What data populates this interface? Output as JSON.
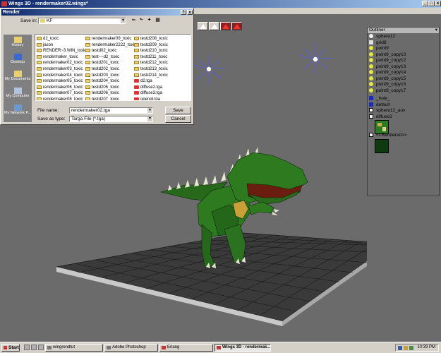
{
  "app": {
    "title": "Wings 3D - rendermaker02.wings*",
    "minimize_glyph": "_",
    "maximize_glyph": "□",
    "close_glyph": "x"
  },
  "viewport": {
    "toolbar_modes": [
      "vertex-mode",
      "edge-mode",
      "face-mode",
      "body-mode"
    ],
    "active_modes": [
      2,
      3
    ]
  },
  "outliner": {
    "title": "Outliner",
    "items": [
      {
        "label": "sphere12",
        "icon": "sphere-icon"
      },
      {
        "label": "grid8",
        "icon": "grid-icon"
      },
      {
        "label": "point9",
        "icon": "light-icon"
      },
      {
        "label": "point9_copy10",
        "icon": "light-icon"
      },
      {
        "label": "point9_copy12",
        "icon": "light-icon"
      },
      {
        "label": "point9_copy13",
        "icon": "light-icon"
      },
      {
        "label": "point9_copy14",
        "icon": "light-icon"
      },
      {
        "label": "point9_copy15",
        "icon": "light-icon"
      },
      {
        "label": "point9_copy16",
        "icon": "light-icon"
      },
      {
        "label": "point9_copy17",
        "icon": "light-icon"
      },
      {
        "label": "_hole_",
        "icon": "material-icon"
      },
      {
        "label": "default",
        "icon": "material-icon"
      },
      {
        "label": "sphere12_auv",
        "icon": "image-icon"
      },
      {
        "label": "diffuse2",
        "icon": "image-icon"
      },
      {
        "label": "<<Rendered>>",
        "icon": "image-icon"
      }
    ]
  },
  "dialog": {
    "title": "Render",
    "help_glyph": "?",
    "close_glyph": "x",
    "save_in_label": "Save in:",
    "save_in_value": "KF",
    "places": [
      {
        "label": "History",
        "icon": "history-icon"
      },
      {
        "label": "Desktop",
        "icon": "desktop-icon"
      },
      {
        "label": "My Documents",
        "icon": "my-documents-icon"
      },
      {
        "label": "My Computer",
        "icon": "my-computer-icon"
      },
      {
        "label": "My Network P...",
        "icon": "my-network-icon"
      }
    ],
    "files": [
      {
        "name": "d2_toxic",
        "type": "folder"
      },
      {
        "name": "jason",
        "type": "folder"
      },
      {
        "name": "RENDER~3.WIN_toxic",
        "type": "folder"
      },
      {
        "name": "rendermaker_toxic",
        "type": "folder"
      },
      {
        "name": "rendermaker02_toxic",
        "type": "folder"
      },
      {
        "name": "rendermaker03_toxic",
        "type": "folder"
      },
      {
        "name": "rendermaker04_toxic",
        "type": "folder"
      },
      {
        "name": "rendermaker05_toxic",
        "type": "folder"
      },
      {
        "name": "rendermaker06_toxic",
        "type": "folder"
      },
      {
        "name": "rendermaker07_toxic",
        "type": "folder"
      },
      {
        "name": "rendermaker08_toxic",
        "type": "folder"
      },
      {
        "name": "rendermaker09_toxic",
        "type": "folder"
      },
      {
        "name": "rendermaker2222_toxic",
        "type": "folder"
      },
      {
        "name": "testd02_toxic",
        "type": "folder"
      },
      {
        "name": "test~~d2_toxic",
        "type": "folder"
      },
      {
        "name": "testd201_toxic",
        "type": "folder"
      },
      {
        "name": "testd202_toxic",
        "type": "folder"
      },
      {
        "name": "testd203_toxic",
        "type": "folder"
      },
      {
        "name": "testd204_toxic",
        "type": "folder"
      },
      {
        "name": "testd205_toxic",
        "type": "folder"
      },
      {
        "name": "testd206_toxic",
        "type": "folder"
      },
      {
        "name": "testd207_toxic",
        "type": "folder"
      },
      {
        "name": "testd208_toxic",
        "type": "folder"
      },
      {
        "name": "testd209_toxic",
        "type": "folder"
      },
      {
        "name": "testd210_toxic",
        "type": "folder"
      },
      {
        "name": "testd211_toxic",
        "type": "folder"
      },
      {
        "name": "testd212_toxic",
        "type": "folder"
      },
      {
        "name": "testd213_toxic",
        "type": "folder"
      },
      {
        "name": "testd214_toxic",
        "type": "folder"
      },
      {
        "name": "d2.tga",
        "type": "tga"
      },
      {
        "name": "diffuse2.tga",
        "type": "tga"
      },
      {
        "name": "diffuse3.tga",
        "type": "tga"
      },
      {
        "name": "opengl.tga",
        "type": "tga"
      }
    ],
    "file_name_label": "File name:",
    "file_name_value": "rendermaker02.tga",
    "save_as_type_label": "Save as type:",
    "save_as_type_value": "Targa File (*.tga)",
    "save_label": "Save",
    "cancel_label": "Cancel"
  },
  "taskbar": {
    "start_label": "Start",
    "tasks": [
      {
        "label": "wingrendtut",
        "active": false
      },
      {
        "label": "Adobe Photoshop",
        "active": false
      },
      {
        "label": "Erlang",
        "active": false
      },
      {
        "label": "Wings 3D - rendermak...",
        "active": true
      }
    ],
    "clock": "10:39 PM"
  },
  "colors": {
    "title_bar": "#0a246a",
    "viewport_bg": "#6b6b6b",
    "dino_green": "#2e7a1f",
    "floor": "#3c3c3c"
  }
}
